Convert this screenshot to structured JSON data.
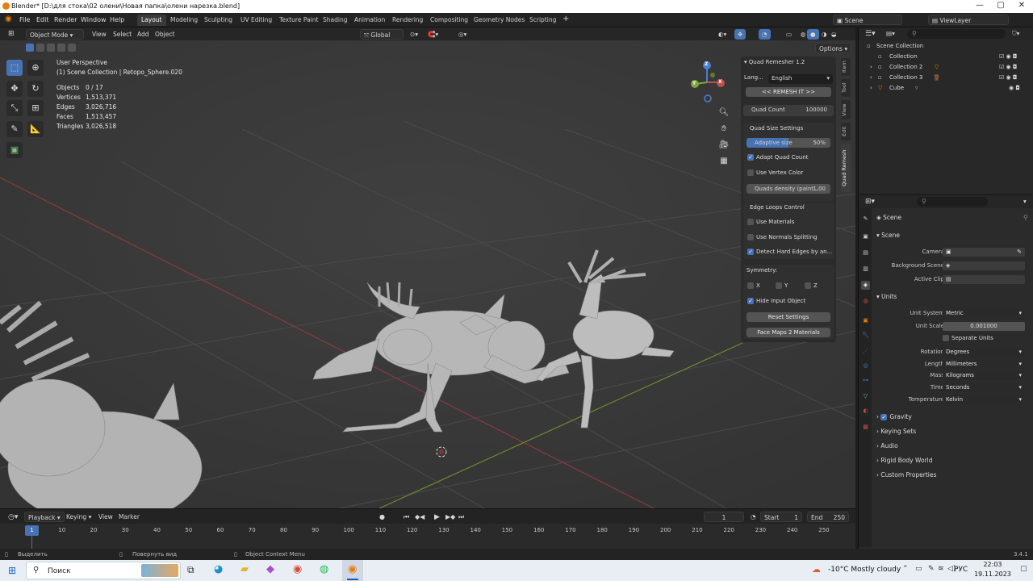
{
  "window": {
    "title": "Blender* [D:\\для стока\\02 олени\\Новая папка\\олени нарезка.blend]"
  },
  "menu": {
    "items": [
      "File",
      "Edit",
      "Render",
      "Window",
      "Help"
    ],
    "workspaces": [
      "Layout",
      "Modeling",
      "Sculpting",
      "UV Editing",
      "Texture Paint",
      "Shading",
      "Animation",
      "Rendering",
      "Compositing",
      "Geometry Nodes",
      "Scripting"
    ],
    "active_workspace": "Layout",
    "add_tab": "+",
    "scene": "Scene",
    "view_layer": "ViewLayer"
  },
  "viewport_header": {
    "mode": "Object Mode",
    "menus": [
      "View",
      "Select",
      "Add",
      "Object"
    ],
    "orientation": "Global",
    "options": "Options"
  },
  "viewport": {
    "perspective": "User Perspective",
    "collection": "(1) Scene Collection | Retopo_Sphere.020",
    "stats": [
      {
        "label": "Objects",
        "value": "0 / 17"
      },
      {
        "label": "Vertices",
        "value": "1,513,371"
      },
      {
        "label": "Edges",
        "value": "3,026,716"
      },
      {
        "label": "Faces",
        "value": "1,513,457"
      },
      {
        "label": "Triangles",
        "value": "3,026,518"
      }
    ],
    "gizmo": {
      "x": "X",
      "y": "Y",
      "z": "Z"
    }
  },
  "quad_remesher": {
    "title": "Quad Remesher 1.2",
    "lang_label": "Lang...",
    "lang_value": "English",
    "remesh_button": "<< REMESH IT >>",
    "quad_count_label": "Quad Count",
    "quad_count_value": "100000",
    "size_section": "Quad Size Settings",
    "adaptive_label": "Adaptive size",
    "adaptive_value": "50%",
    "adaptive_fraction": 0.5,
    "adapt_quad_count": "Adapt Quad Count",
    "use_vertex_color": "Use Vertex Color",
    "density_label": "Quads density (paint...",
    "density_value": "1.00",
    "edge_loops_section": "Edge Loops Control",
    "use_materials": "Use Materials",
    "use_normals": "Use Normals Splitting",
    "detect_hard": "Detect Hard Edges by an...",
    "symmetry_label": "Symmetry:",
    "sym_x": "X",
    "sym_y": "Y",
    "sym_z": "Z",
    "hide_input": "Hide Input Object",
    "reset_button": "Reset Settings",
    "face_maps_button": "Face Maps 2 Materials",
    "side_tabs": [
      "Item",
      "Tool",
      "View",
      "Edit",
      "Quad Remesh"
    ]
  },
  "timeline": {
    "menus": [
      "Playback",
      "Keying",
      "View",
      "Marker"
    ],
    "current_frame": "1",
    "start_label": "Start",
    "start_value": "1",
    "end_label": "End",
    "end_value": "250",
    "ticks": [
      "10",
      "20",
      "30",
      "40",
      "50",
      "60",
      "70",
      "80",
      "90",
      "100",
      "110",
      "120",
      "130",
      "140",
      "150",
      "160",
      "170",
      "180",
      "190",
      "200",
      "210",
      "220",
      "230",
      "240",
      "250"
    ],
    "playhead": "1"
  },
  "statusbar": {
    "select": "Выделить",
    "rotate": "Повернуть вид",
    "context": "Object Context Menu",
    "version": "3.4.1"
  },
  "outliner": {
    "root": "Scene Collection",
    "items": [
      "Collection",
      "Collection 2",
      "Collection 3",
      "Cube"
    ]
  },
  "properties": {
    "breadcrumb": "Scene",
    "scene_section": "Scene",
    "camera_label": "Camera",
    "bg_scene_label": "Background Scene",
    "active_clip_label": "Active Clip",
    "units_section": "Units",
    "unit_system_label": "Unit System",
    "unit_system_value": "Metric",
    "unit_scale_label": "Unit Scale",
    "unit_scale_value": "0.001000",
    "separate_units": "Separate Units",
    "rotation_label": "Rotation",
    "rotation_value": "Degrees",
    "length_label": "Length",
    "length_value": "Millimeters",
    "mass_label": "Mass",
    "mass_value": "Kilograms",
    "time_label": "Time",
    "time_value": "Seconds",
    "temperature_label": "Temperature",
    "temperature_value": "Kelvin",
    "collapsed": [
      "Gravity",
      "Keying Sets",
      "Audio",
      "Rigid Body World",
      "Custom Properties"
    ]
  },
  "taskbar": {
    "search": "Поиск",
    "weather": "-10°C  Mostly cloudy",
    "lang": "РУС",
    "time": "22:03",
    "date": "19.11.2023"
  },
  "colors": {
    "accent": "#4772b3",
    "blender_orange": "#e87d0d",
    "x_axis": "#c0504d",
    "y_axis": "#7fa63a",
    "z_axis": "#4a7fd0"
  }
}
